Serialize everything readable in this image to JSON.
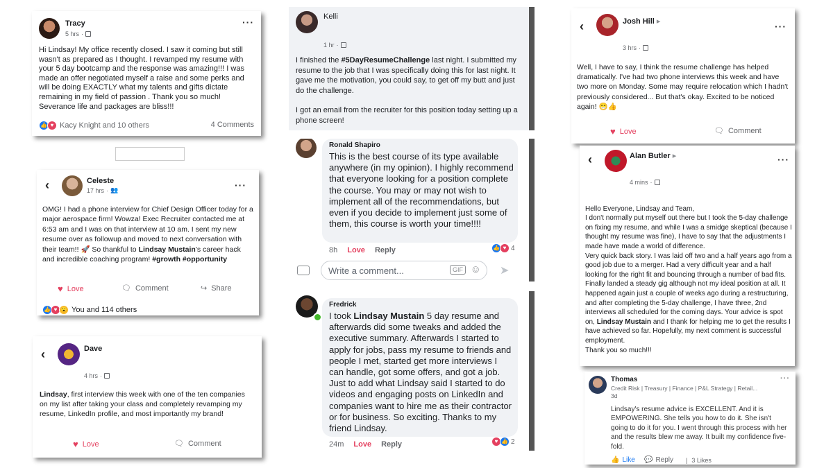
{
  "tracy": {
    "name": "Tracy",
    "time": "5 hrs",
    "text": "Hi Lindsay! My office recently closed. I saw it coming but still wasn't as prepared as I thought. I revamped my resume with your 5 day bootcamp and the response was amazing!!! I was made an offer negotiated myself a raise and some perks and will be doing EXACTLY what my talents and gifts dictate remaining in my field of passion . Thank you so much! Severance life and packages are bliss!!!",
    "reactions": "Kacy Knight and 10 others",
    "comments": "4 Comments"
  },
  "celeste": {
    "name": "Celeste",
    "time": "17 hrs",
    "text_a": "OMG! I had a phone interview for Chief Design Officer today for a major aerospace firm! Wowza! Exec Recruiter contacted me at 6:53 am and I was on that interview at 10 am. I sent my new resume over as followup and moved to next conversation with their team!! 🚀 So thankful to ",
    "text_bold": "Lindsay Mustain",
    "text_b": "'s career hack and incredible coaching program! ",
    "hashtags": "#growth #opportunity",
    "love": "Love",
    "comment": "Comment",
    "share": "Share",
    "reactions": "You and 114 others"
  },
  "dave": {
    "name": "Dave",
    "time": "4 hrs",
    "text_bold": "Lindsay",
    "text": ", first interview this week with one of the ten companies on my list after taking your class and completely revamping my resume, LinkedIn profile, and most importantly my brand!",
    "love": "Love",
    "comment": "Comment"
  },
  "kelli": {
    "name": "Kelli",
    "time": "1 hr",
    "text_a": "I finished the ",
    "text_bold": "#5DayResumeChallenge",
    "text_b": " last night.  I submitted my resume to the job that I was specifically doing this for last night. It gave me the motivation, you could say, to get off my butt and just do the challenge.",
    "text_c": "I got an email from the recruiter for this position today setting up a phone screen!"
  },
  "ronald": {
    "name": "Ronald Shapiro",
    "text": "This is the best course of its type available anywhere (in my opinion).  I highly recommend that everyone looking for a position complete the course. You may or may not wish to implement all of the recommendations, but even if you decide to implement just some of them, this course is worth your time!!!!",
    "time": "8h",
    "love": "Love",
    "reply": "Reply",
    "count": "4",
    "comment_placeholder": "Write a comment..."
  },
  "fredrick": {
    "name": "Fredrick",
    "text_a": "I took ",
    "text_bold": "Lindsay Mustain",
    "text_b": " 5 day resume and afterwards did some tweaks and added the executive summary. Afterwards I started to apply for jobs, pass my resume to friends and people I met, started get more interviews I can handle, got some offers, and got a job. Just to add what Lindsay said I started to do videos and engaging posts on LinkedIn and companies want to hire me as their contractor or for business. So exciting. Thanks to my friend Lindsay.",
    "time": "24m",
    "love": "Love",
    "reply": "Reply",
    "count": "2"
  },
  "josh": {
    "name": "Josh Hill",
    "time": "3 hrs",
    "text": "Well, I have to say, I think the resume challenge has helped dramatically. I've had two phone interviews this week and have two more on Monday. Some may require relocation which I hadn't previously considered... But that's okay. Excited to be noticed again! 😁👍",
    "love": "Love",
    "comment": "Comment"
  },
  "alan": {
    "name": "Alan Butler",
    "time": "4 mins",
    "text_a": "Hello Everyone, Lindsay and Team,\nI don't normally put myself out there but I took the 5-day challenge on fixing my resume, and while I was a smidge skeptical (because I thought my resume was fine), I have to say that the adjustments I made have made a world of difference.\nVery quick back story. I was laid off two and a half years ago from a good job due to a merger. Had a very difficult year and a half looking for the right fit and bouncing through a number of bad fits. Finally landed a steady gig although not my ideal position at all. It happened again just a couple of weeks ago during a restructuring, and after completing the 5-day challenge, I have three, 2nd interviews all scheduled for the coming days. Your advice is spot on, ",
    "text_bold": "Lindsay Mustain",
    "text_b": " and I thank for helping me to get the results I have achieved so far. Hopefully, my next comment is successful employment.\nThank you so much!!!"
  },
  "thomas": {
    "name": "Thomas",
    "headline": "Credit Risk | Treasury | Finance | P&L Strategy | Retail...",
    "time": "3d",
    "text": "Lindsay's resume advice is EXCELLENT. And it is EMPOWERING. She tells you how to do it.  She isn't going to do it for you.  I went through this process with her and the results blew me away.  It built my confidence five-fold.",
    "like": "Like",
    "reply": "Reply",
    "likes": "3 Likes"
  },
  "colors": {
    "love": "#e4405f",
    "like": "#1877f2",
    "meta": "#65676b"
  }
}
